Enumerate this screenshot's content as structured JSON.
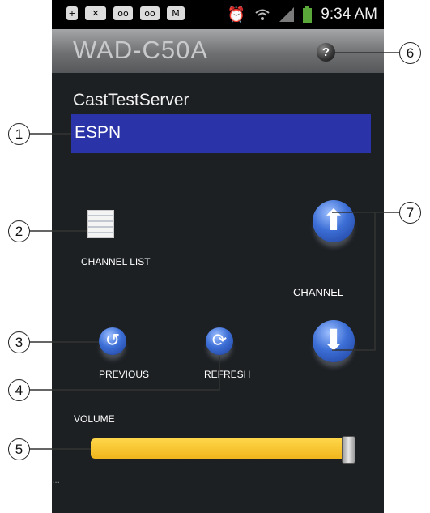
{
  "status_bar": {
    "time": "9:34 AM",
    "left_icons": [
      "plus-icon",
      "missed-call-icon",
      "voicemail-icon",
      "voicemail-icon",
      "gmail-icon"
    ],
    "right_icons": [
      "alarm-icon",
      "wifi-icon",
      "signal-icon",
      "battery-icon"
    ]
  },
  "header": {
    "title": "WAD-C50A",
    "help_symbol": "?"
  },
  "server_name": "CastTestServer",
  "current_channel": "ESPN",
  "controls": {
    "channel_list_label": "CHANNEL LIST",
    "channel_label": "CHANNEL",
    "previous_label": "PREVIOUS",
    "refresh_label": "REFRESH",
    "volume_label": "VOLUME",
    "volume_level_fraction": 0.95
  },
  "callouts": [
    "1",
    "2",
    "3",
    "4",
    "5",
    "6",
    "7"
  ],
  "colors": {
    "channel_box": "#2a33a8",
    "volume_bar": "#f5c02a",
    "background": "#1d2023"
  }
}
